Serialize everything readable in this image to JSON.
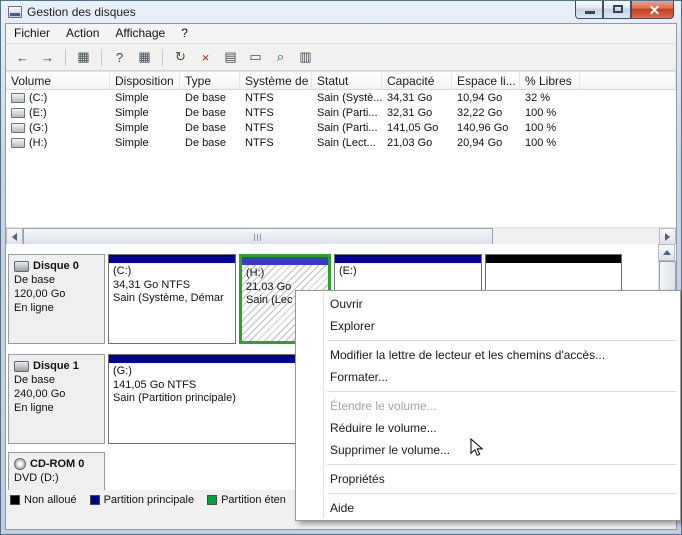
{
  "window": {
    "title": "Gestion des disques"
  },
  "menubar": {
    "items": [
      {
        "label": "Fichier"
      },
      {
        "label": "Action"
      },
      {
        "label": "Affichage"
      },
      {
        "label": "?"
      }
    ]
  },
  "toolbar": {
    "icons": [
      {
        "name": "back",
        "glyph": "←"
      },
      {
        "name": "forward",
        "glyph": "→"
      },
      {
        "name": "show-console-tree",
        "glyph": "▦"
      },
      {
        "name": "help",
        "glyph": "?"
      },
      {
        "name": "show-action-pane",
        "glyph": "▦"
      },
      {
        "name": "refresh",
        "glyph": "↻"
      },
      {
        "name": "delete",
        "glyph": "×"
      },
      {
        "name": "properties",
        "glyph": "▤"
      },
      {
        "name": "open",
        "glyph": "▭"
      },
      {
        "name": "search",
        "glyph": "⌕"
      },
      {
        "name": "disk-view",
        "glyph": "▥"
      }
    ]
  },
  "volume_list": {
    "columns": [
      "Volume",
      "Disposition",
      "Type",
      "Système de ...",
      "Statut",
      "Capacité",
      "Espace li...",
      "% Libres"
    ],
    "rows": [
      {
        "volume": "(C:)",
        "disposition": "Simple",
        "type": "De base",
        "fs": "NTFS",
        "statut": "Sain (Systè...",
        "capacite": "34,31 Go",
        "espace": "10,94 Go",
        "libres": "32 %"
      },
      {
        "volume": "(E:)",
        "disposition": "Simple",
        "type": "De base",
        "fs": "NTFS",
        "statut": "Sain (Parti...",
        "capacite": "32,31 Go",
        "espace": "32,22 Go",
        "libres": "100 %"
      },
      {
        "volume": "(G:)",
        "disposition": "Simple",
        "type": "De base",
        "fs": "NTFS",
        "statut": "Sain (Parti...",
        "capacite": "141,05 Go",
        "espace": "140,96 Go",
        "libres": "100 %"
      },
      {
        "volume": "(H:)",
        "disposition": "Simple",
        "type": "De base",
        "fs": "NTFS",
        "statut": "Sain (Lect...",
        "capacite": "21,03 Go",
        "espace": "20,94 Go",
        "libres": "100 %"
      }
    ]
  },
  "disks": [
    {
      "name": "Disque 0",
      "type": "De base",
      "size": "120,00 Go",
      "status": "En ligne",
      "partitions": [
        {
          "label": "(C:)",
          "size": "34,31 Go NTFS",
          "status": "Sain (Système, Démar"
        },
        {
          "label": "(H:)",
          "size": "21,03 Go",
          "status": "Sain (Lec"
        },
        {
          "label": "(E:)",
          "size": "",
          "status": ""
        },
        {
          "label": "",
          "size": "",
          "status": ""
        }
      ]
    },
    {
      "name": "Disque 1",
      "type": "De base",
      "size": "240,00 Go",
      "status": "En ligne",
      "partitions": [
        {
          "label": "(G:)",
          "size": "141,05 Go NTFS",
          "status": "Sain (Partition principale)"
        }
      ]
    },
    {
      "name": "CD-ROM 0",
      "type": "DVD (D:)",
      "size": "",
      "status": ""
    }
  ],
  "legend": {
    "items": [
      {
        "label": "Non alloué",
        "color": "#000000"
      },
      {
        "label": "Partition principale",
        "color": "#000096"
      },
      {
        "label": "Partition éten",
        "color": "#00a23c"
      }
    ]
  },
  "context_menu": {
    "items": [
      {
        "label": "Ouvrir"
      },
      {
        "label": "Explorer"
      },
      {
        "separator": true
      },
      {
        "label": "Modifier la lettre de lecteur et les chemins d'accès..."
      },
      {
        "label": "Formater..."
      },
      {
        "separator": true
      },
      {
        "label": "Étendre le volume...",
        "disabled": true
      },
      {
        "label": "Réduire le volume..."
      },
      {
        "label": "Supprimer le volume..."
      },
      {
        "separator": true
      },
      {
        "label": "Propriétés"
      },
      {
        "separator": true
      },
      {
        "label": "Aide"
      }
    ]
  },
  "colors": {
    "primary_partition_band": "#000096",
    "logical_drive_band": "#3c3ccc",
    "unallocated_band": "#000000",
    "extended_partition_border": "#2aa32a"
  }
}
